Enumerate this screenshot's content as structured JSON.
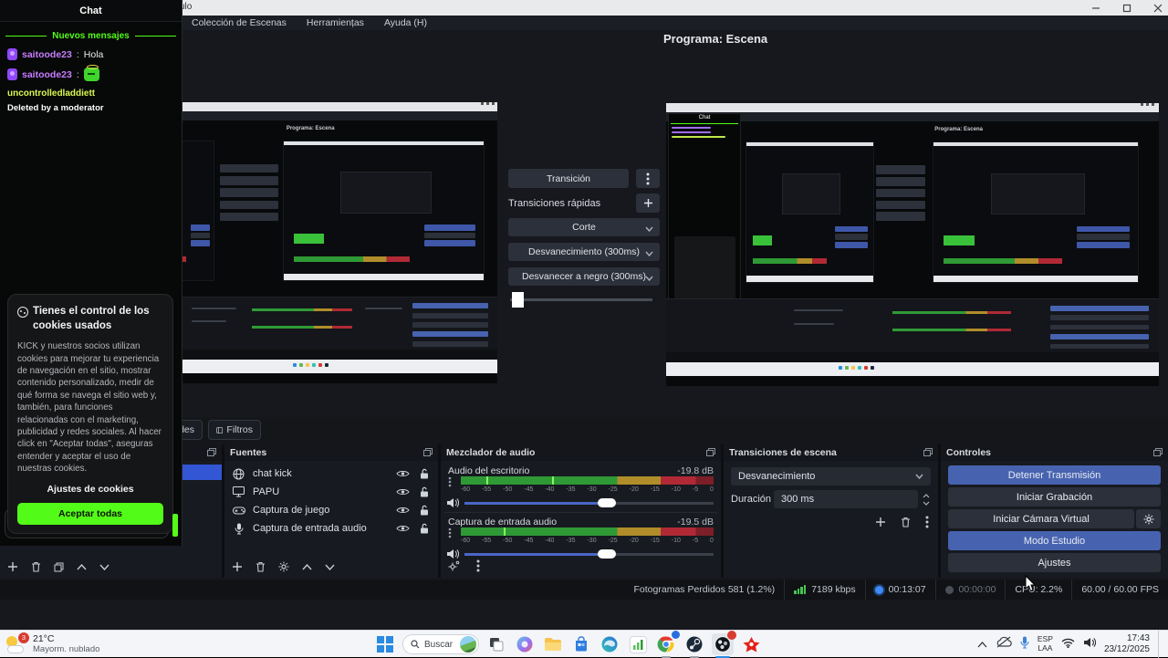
{
  "window": {
    "title_fragment": "ulo",
    "menu_items": [
      "Colección de Escenas",
      "Herramiențas",
      "Ayuda (H)"
    ]
  },
  "chat": {
    "title": "Chat",
    "divider_label": "Nuevos mensajes",
    "messages": [
      {
        "user": "saitoode23",
        "sep": ":",
        "text": "Hola"
      },
      {
        "user": "saitoode23",
        "sep": ":",
        "emoji": "angel-emote"
      },
      {
        "user": "uncontrolledladdiett",
        "sep": ":",
        "text": "Deleted by a moderator"
      }
    ],
    "cookie_dialog": {
      "title": "Tienes el control de los cookies usados",
      "body": "KICK y nuestros socios utilizan cookies para mejorar tu experiencia de navegación en el sitio, mostrar contenido personalizado, medir de qué forma se navega el sitio web y, también, para funciones relacionadas con el marketing, publicidad y redes sociales. Al hacer click en \"Aceptar todas\", aseguras entender y aceptar el uso de nuestras cookies.",
      "settings_label": "Ajustes de cookies",
      "accept_label": "Aceptar todas"
    }
  },
  "studio": {
    "program_label": "Programa: Escena",
    "transition_button": "Transición",
    "quick_transitions_label": "Transiciones rápidas",
    "quick_transitions": [
      "Corte",
      "Desvanecimiento (300ms)",
      "Desvanecer a negro (300ms)"
    ]
  },
  "source_toolbar": {
    "properties_fragment": "des",
    "filters_label": "Filtros"
  },
  "docks": {
    "sources": {
      "title": "Fuentes",
      "items": [
        {
          "label": "chat kick",
          "icon": "globe"
        },
        {
          "label": "PAPU",
          "icon": "display"
        },
        {
          "label": "Captura de juego",
          "icon": "gamepad"
        },
        {
          "label": "Captura de entrada audio",
          "icon": "microphone"
        }
      ]
    },
    "mixer": {
      "title": "Mezclador de audio",
      "channels": [
        {
          "name": "Audio del escritorio",
          "db": "-19.8 dB"
        },
        {
          "name": "Captura de entrada audio",
          "db": "-19.5 dB"
        }
      ],
      "ticks": [
        "-60",
        "-55",
        "-50",
        "-45",
        "-40",
        "-35",
        "-30",
        "-25",
        "-20",
        "-15",
        "-10",
        "-5",
        "0"
      ]
    },
    "scene_transitions": {
      "title": "Transiciones de escena",
      "selected": "Desvanecimiento",
      "duration_label": "Duración",
      "duration_value": "300 ms"
    },
    "controls": {
      "title": "Controles",
      "buttons": [
        "Detener Transmisión",
        "Iniciar Grabación",
        "Iniciar Cámara Virtual",
        "Modo Estudio",
        "Ajustes"
      ]
    }
  },
  "statusbar": {
    "dropped_frames": "Fotogramas Perdidos 581 (1.2%)",
    "bitrate": "7189 kbps",
    "stream_time": "00:13:07",
    "rec_time": "00:00:00",
    "cpu": "CPU: 2.2%",
    "fps": "60.00 / 60.00 FPS"
  },
  "taskbar": {
    "weather_badge": "3",
    "weather_temp": "21°C",
    "weather_desc": "Mayorm. nublado",
    "search_label": "Buscar",
    "tray_lang_line1": "ESP",
    "tray_lang_line2": "LAA",
    "time": "17:43",
    "date": "23/12/2025"
  },
  "colors": {
    "kick_green": "#53fc18",
    "accent_blue": "#4763b0",
    "selected_scene_blue": "#3256d4"
  }
}
